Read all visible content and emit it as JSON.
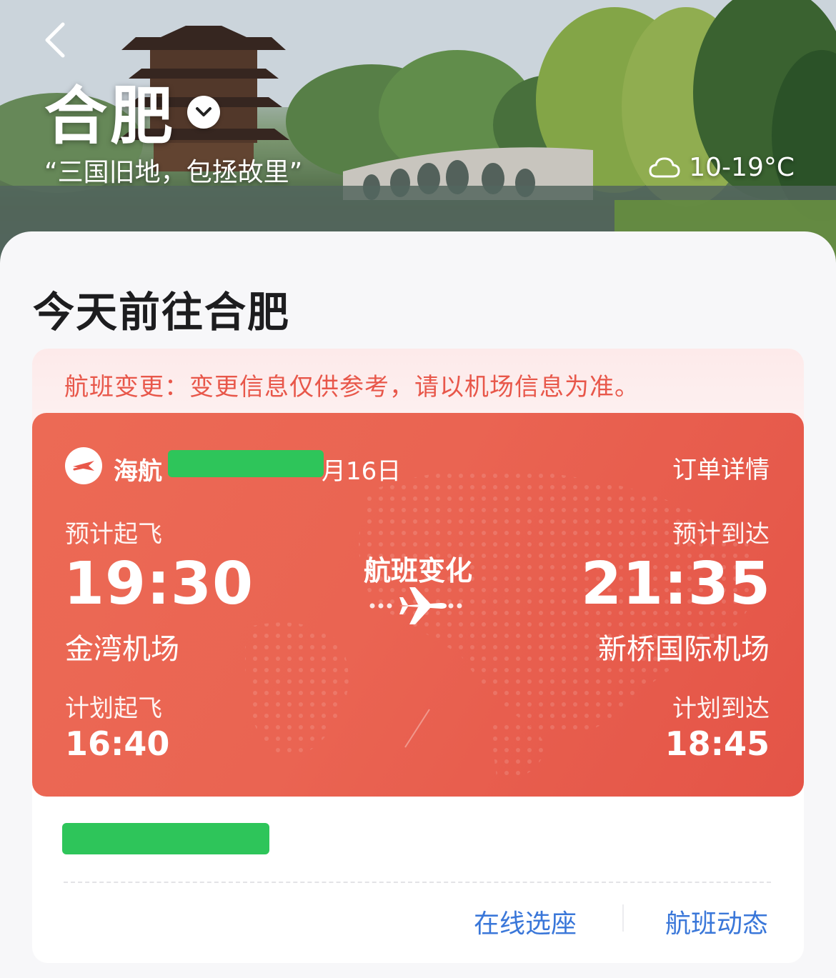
{
  "header": {
    "city": "合肥",
    "slogan": "“三国旧地，包拯故里”",
    "weather": {
      "icon": "cloud-icon",
      "temperature": "10-19°C"
    }
  },
  "section": {
    "title": "今天前往合肥"
  },
  "notice": {
    "text": "航班变更：变更信息仅供参考，请以机场信息为准。",
    "color": "#e8574a"
  },
  "flight": {
    "airline": "海航",
    "date_suffix": "月16日",
    "order_detail_label": "订单详情",
    "status": "航班变化",
    "departure": {
      "estimated_label": "预计起飞",
      "estimated_time": "19:30",
      "airport": "金湾机场",
      "scheduled_label": "计划起飞",
      "scheduled_time": "16:40"
    },
    "arrival": {
      "estimated_label": "预计到达",
      "estimated_time": "21:35",
      "airport": "新桥国际机场",
      "scheduled_label": "计划到达",
      "scheduled_time": "18:45"
    },
    "card_color": "#ea6452"
  },
  "actions": {
    "select_seat": "在线选座",
    "flight_status": "航班动态",
    "link_color": "#3a77d9"
  }
}
